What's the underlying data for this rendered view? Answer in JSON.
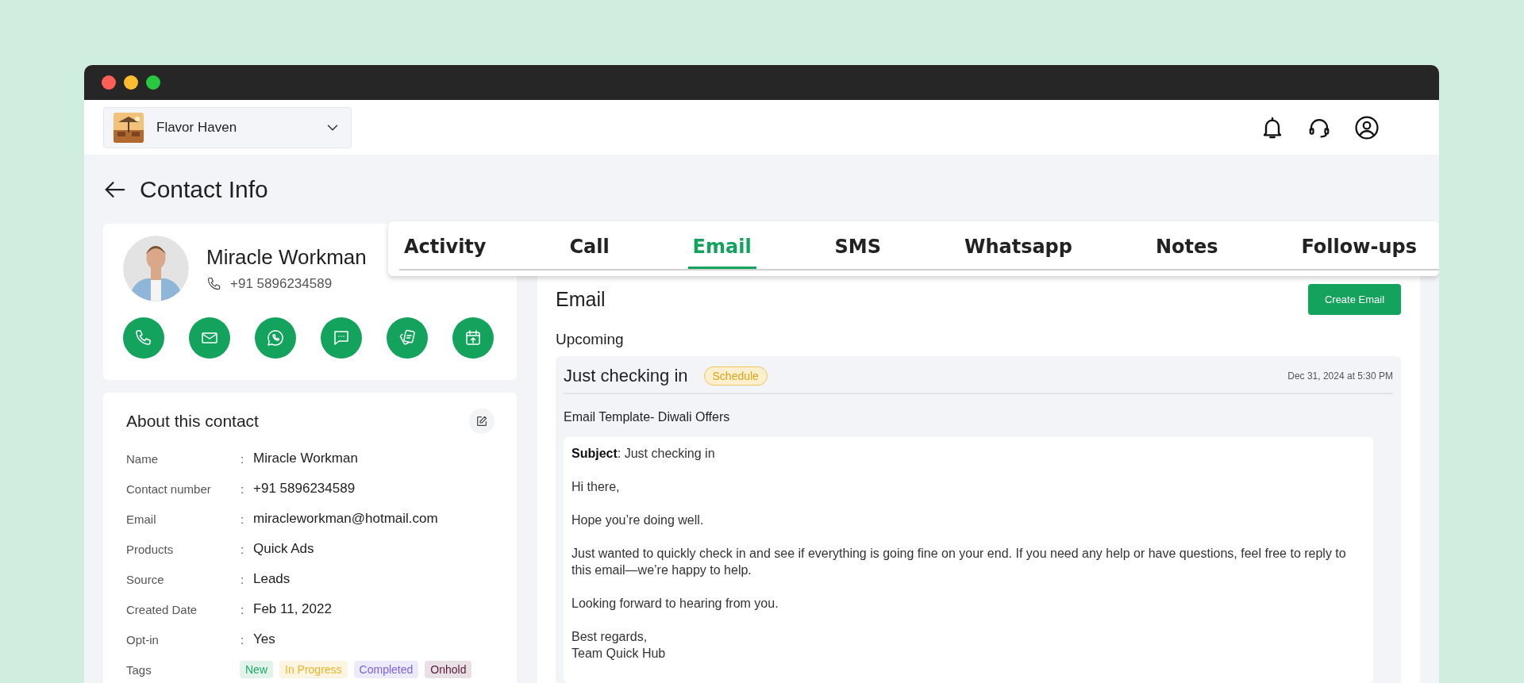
{
  "workspace": {
    "name": "Flavor Haven"
  },
  "page_title": "Contact Info",
  "contact": {
    "name": "Miracle Workman",
    "phone": "+91 5896234589"
  },
  "about": {
    "title": "About this contact",
    "fields": [
      {
        "label": "Name",
        "separator": ":",
        "value": "Miracle Workman"
      },
      {
        "label": "Contact number",
        "separator": ":",
        "value": "+91 5896234589"
      },
      {
        "label": "Email",
        "separator": ":",
        "value": "miracleworkman@hotmail.com"
      },
      {
        "label": "Products",
        "separator": ":",
        "value": "Quick Ads"
      },
      {
        "label": "Source",
        "separator": ":",
        "value": "Leads"
      },
      {
        "label": "Created Date",
        "separator": ":",
        "value": "Feb 11, 2022"
      },
      {
        "label": "Opt-in",
        "separator": ":",
        "value": "Yes"
      }
    ],
    "tags_label": "Tags",
    "tags": [
      {
        "label": "New",
        "color": "#1fa86a"
      },
      {
        "label": "In Progress",
        "color": "#f0b429"
      },
      {
        "label": "Completed",
        "color": "#7a63e0"
      },
      {
        "label": "Onhold",
        "color": "#5a1a3a"
      }
    ]
  },
  "tabs": [
    {
      "label": "Activity",
      "selected": false
    },
    {
      "label": "Call",
      "selected": false
    },
    {
      "label": "Email",
      "selected": true
    },
    {
      "label": "SMS",
      "selected": false
    },
    {
      "label": "Whatsapp",
      "selected": false
    },
    {
      "label": "Notes",
      "selected": false
    },
    {
      "label": "Follow-ups",
      "selected": false
    }
  ],
  "email_panel": {
    "title": "Email",
    "create_button": "Create Email",
    "section": "Upcoming",
    "items": [
      {
        "subject": "Just checking in",
        "status": "Schedule",
        "date": "Dec 31, 2024 at 5:30 PM",
        "template": "Email Template- Diwali Offers",
        "body": [
          "**Subject**: Just checking in",
          "Hi there,",
          "Hope you’re doing well.",
          "Just wanted to quickly check in and see if everything is going fine on your end. If you need any help or have questions, feel free to reply to this email—we’re happy to help.",
          "Looking forward to hearing from you.",
          "Best regards,\nTeam Quick Hub"
        ]
      }
    ]
  }
}
